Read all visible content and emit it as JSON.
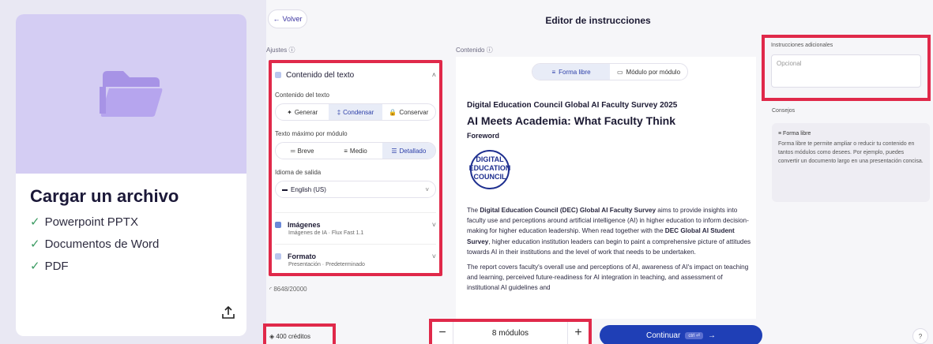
{
  "upload": {
    "title": "Cargar un archivo",
    "items": [
      "Powerpoint PPTX",
      "Documentos de Word",
      "PDF"
    ]
  },
  "header": {
    "back_label": "Volver",
    "title": "Editor de instrucciones"
  },
  "columns": {
    "settings_label": "Ajustes",
    "content_label": "Contenido",
    "instructions_label": "Instrucciones adicionales",
    "tips_label": "Consejos"
  },
  "settings": {
    "text_section_title": "Contenido del texto",
    "text_content_label": "Contenido del texto",
    "text_modes": [
      "Generar",
      "Condensar",
      "Conservar"
    ],
    "selected_text_mode": "Condensar",
    "max_text_label": "Texto máximo por módulo",
    "lengths": [
      "Breve",
      "Medio",
      "Detallado"
    ],
    "selected_length": "Medio",
    "output_language_label": "Idioma de salida",
    "language": "English (US)",
    "images_title": "Imágenes",
    "images_sub": "Imágenes de IA · Flux Fast 1.1",
    "format_title": "Formato",
    "format_sub": "Presentación · Predeterminado",
    "char_count": "8648/20000"
  },
  "content": {
    "modes": [
      "Forma libre",
      "Módulo por módulo"
    ],
    "selected_mode": "Forma libre",
    "doc_title": "Digital Education Council Global AI Faculty Survey 2025",
    "doc_heading": "AI Meets Academia: What Faculty Think",
    "doc_subheading": "Foreword",
    "logo_lines": [
      "DIGITAL",
      "EDUCATION",
      "COUNCIL"
    ],
    "p1_a": "The ",
    "p1_b": "Digital Education Council (DEC) Global AI Faculty Survey",
    "p1_c": " aims to provide insights into faculty use and perceptions around artificial intelligence (AI) in higher education to inform decision-making for higher education leadership. When read together with the ",
    "p1_d": "DEC Global AI Student Survey",
    "p1_e": ", higher education institution leaders can begin to paint a comprehensive picture of attitudes towards AI in their institutions and the level of work that needs to be undertaken.",
    "p2": "The report covers faculty's overall use and perceptions of AI, awareness of AI's impact on teaching and learning, perceived future-readiness for AI integration in teaching, and assessment of institutional AI guidelines and"
  },
  "instructions": {
    "placeholder": "Opcional"
  },
  "tips": {
    "title": "Forma libre",
    "body": "Forma libre te permite ampliar o reducir tu contenido en tantos módulos como desees. Por ejemplo, puedes convertir un documento largo en una presentación concisa."
  },
  "footer": {
    "credits": "400 créditos",
    "modules": "8 módulos",
    "continue_label": "Continuar",
    "shortcut": "ctrl ⏎",
    "help": "?"
  },
  "colors": {
    "highlight": "#e0294a",
    "primary": "#1f3fb6",
    "upload_header": "#d4cdf3"
  }
}
